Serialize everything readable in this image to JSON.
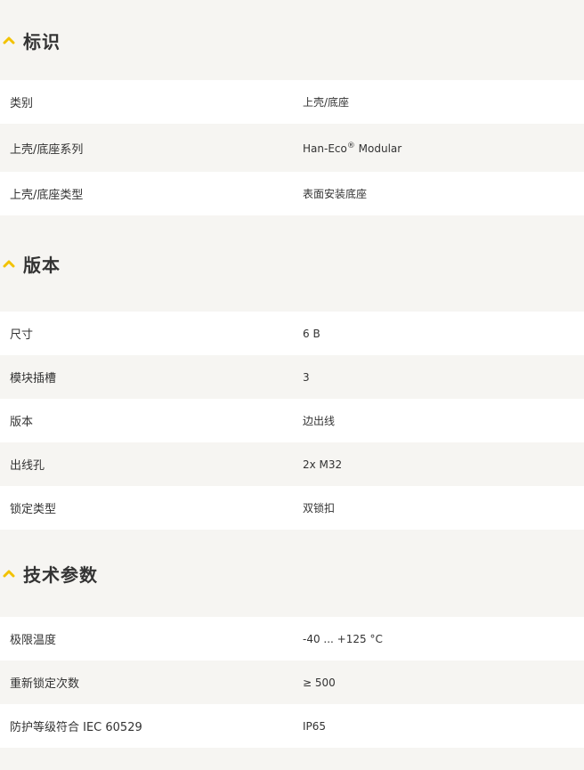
{
  "icons": {
    "chevron": "chevron-up-icon",
    "chevron_color": "#f2c200"
  },
  "sections": [
    {
      "title": "标识",
      "rows": [
        {
          "label": "类别",
          "value": "上壳/底座"
        },
        {
          "label": "上壳/底座系列",
          "value": "Han-Eco",
          "value_sup": "®",
          "value_suffix": " Modular"
        },
        {
          "label": "上壳/底座类型",
          "value": "表面安装底座"
        }
      ]
    },
    {
      "title": "版本",
      "rows": [
        {
          "label": "尺寸",
          "value": "6 B"
        },
        {
          "label": "模块插槽",
          "value": "3"
        },
        {
          "label": "版本",
          "value": "边出线"
        },
        {
          "label": "出线孔",
          "value": "2x M32"
        },
        {
          "label": "锁定类型",
          "value": "双锁扣"
        }
      ]
    },
    {
      "title": "技术参数",
      "rows": [
        {
          "label": "极限温度",
          "value": "-40 ... +125 °C"
        },
        {
          "label": "重新锁定次数",
          "value": "≥ 500"
        },
        {
          "label": "防护等级符合 IEC 60529",
          "value": "IP65"
        }
      ]
    }
  ]
}
